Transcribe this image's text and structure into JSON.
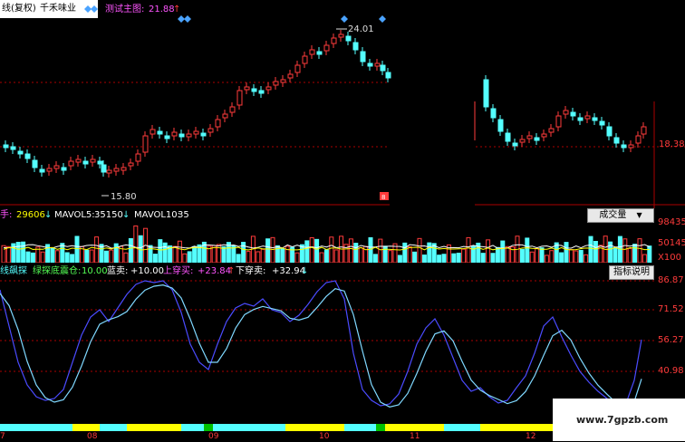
{
  "header": {
    "title": "线(复权)",
    "stock_name": "千禾味业",
    "indicator_label": "测试主图:",
    "indicator_value": "21.88",
    "indicator_arrow": "↑"
  },
  "main_chart": {
    "high_label": "24.01",
    "low_label": "15.80",
    "right_price": "18.38",
    "annotation": "8"
  },
  "volume_panel": {
    "vol_label": "手:",
    "vol_value": "29606",
    "vol_arrow": "↓",
    "mavol5_label": "MAVOL5:",
    "mavol5_value": "35150",
    "mavol5_arrow": "↓",
    "mavol10_label": "MAVOL10:",
    "mavol10_value": "35",
    "dropdown_label": "成交量",
    "dropdown_arrow": "▼",
    "axis": [
      "98435",
      "50145",
      "X100"
    ]
  },
  "indicator_panel": {
    "title": "线飙探",
    "sub": "绿探底震仓:",
    "sub_value": "10.00",
    "blue_sell_label": "蓝卖:",
    "blue_sell_value": "+10.00",
    "up_buy_label": "上穿买:",
    "up_buy_value": "+23.84",
    "up_buy_arrow": "↑",
    "down_sell_label": "下穿卖:",
    "down_sell_value": "+32.94",
    "down_sell_arrow": "↓",
    "help_button": "指标说明",
    "axis": [
      "86.87",
      "71.52",
      "56.27",
      "40.98"
    ]
  },
  "timeline": {
    "labels": [
      "7",
      "08",
      "09",
      "10",
      "11",
      "12"
    ]
  },
  "watermark": "www.7gpzb.com",
  "colors": {
    "up": "#ff3b3b",
    "down": "#54ffff",
    "yellow": "#ffff00",
    "blue_line": "#4b4bff",
    "cyan_line": "#7fd8ff"
  }
}
